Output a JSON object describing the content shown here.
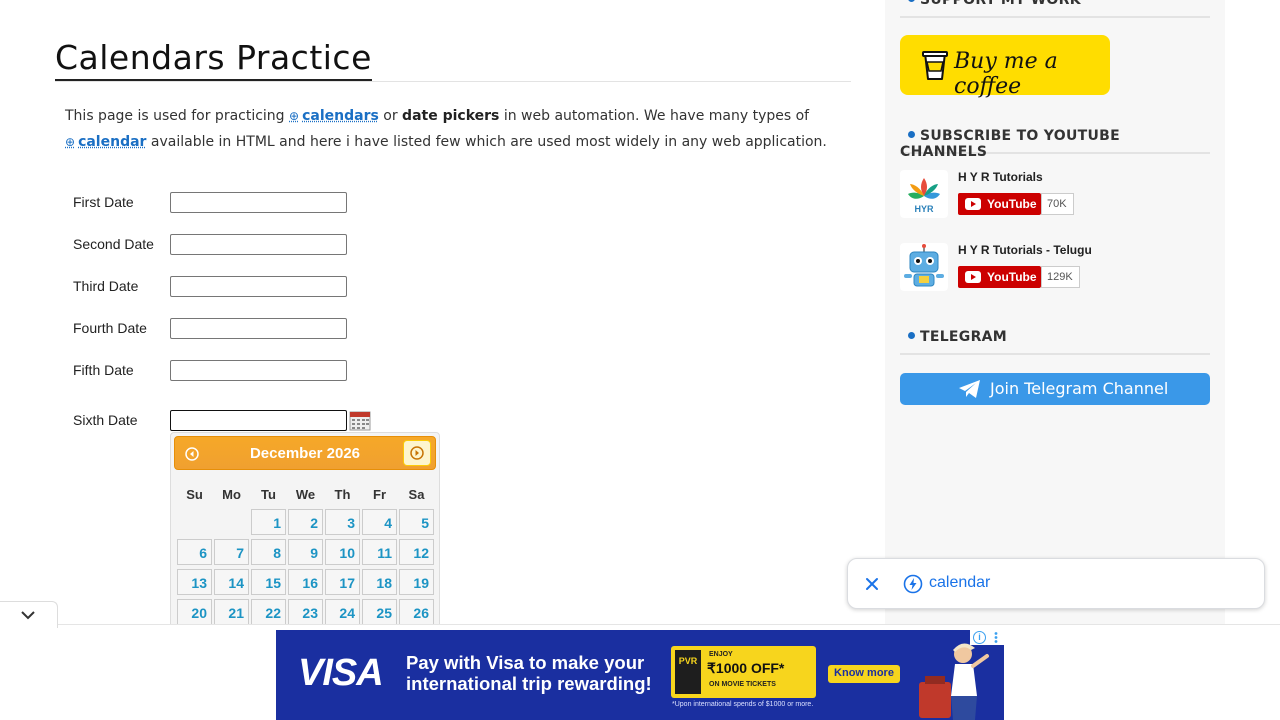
{
  "page": {
    "title": "Calendars Practice",
    "intro": {
      "p1": "This page is used for practicing ",
      "link1": "calendars",
      "p2": " or ",
      "bold1": "date pickers",
      "p3": " in web automation. We have many types of ",
      "link2": "calendar",
      "p4": " available in HTML and here i have listed few which are used most widely in any web application."
    }
  },
  "form": {
    "fields": [
      {
        "label": "First Date",
        "value": ""
      },
      {
        "label": "Second Date",
        "value": ""
      },
      {
        "label": "Third Date",
        "value": ""
      },
      {
        "label": "Fourth Date",
        "value": ""
      },
      {
        "label": "Fifth Date",
        "value": ""
      },
      {
        "label": "Sixth Date",
        "value": ""
      }
    ]
  },
  "datepicker": {
    "month_year": "December 2026",
    "weekdays": [
      "Su",
      "Mo",
      "Tu",
      "We",
      "Th",
      "Fr",
      "Sa"
    ],
    "weeks": [
      [
        "",
        "",
        "1",
        "2",
        "3",
        "4",
        "5"
      ],
      [
        "6",
        "7",
        "8",
        "9",
        "10",
        "11",
        "12"
      ],
      [
        "13",
        "14",
        "15",
        "16",
        "17",
        "18",
        "19"
      ],
      [
        "20",
        "21",
        "22",
        "23",
        "24",
        "25",
        "26"
      ]
    ]
  },
  "sidebar": {
    "support_title": "SUPPORT MY WORK",
    "coffee_label": "Buy me a coffee",
    "youtube_title": "SUBSCRIBE TO YOUTUBE CHANNELS",
    "channels": [
      {
        "name": "H Y R Tutorials",
        "button": "YouTube",
        "count": "70K"
      },
      {
        "name": "H Y R Tutorials - Telugu",
        "button": "YouTube",
        "count": "129K"
      }
    ],
    "telegram_title": "TELEGRAM",
    "telegram_button": "Join Telegram Channel"
  },
  "search_chip": {
    "text": "calendar"
  },
  "ad": {
    "brand": "VISA",
    "headline": "Pay with Visa to make your international trip rewarding!",
    "pvr": "PVR",
    "offer_small": "ENJOY",
    "offer_big": "₹1000 OFF*",
    "offer_sub": "ON MOVIE TICKETS",
    "cta": "Know more",
    "footnote": "*Upon international spends of $1000 or more."
  },
  "colors": {
    "accent": "#1a6fc4",
    "datepicker_header": "#f6a828",
    "day_text": "#1c94c4",
    "coffee": "#ffdd00",
    "youtube": "#cc0000",
    "telegram": "#3a98e8",
    "ad_bg": "#1a2fa0"
  }
}
